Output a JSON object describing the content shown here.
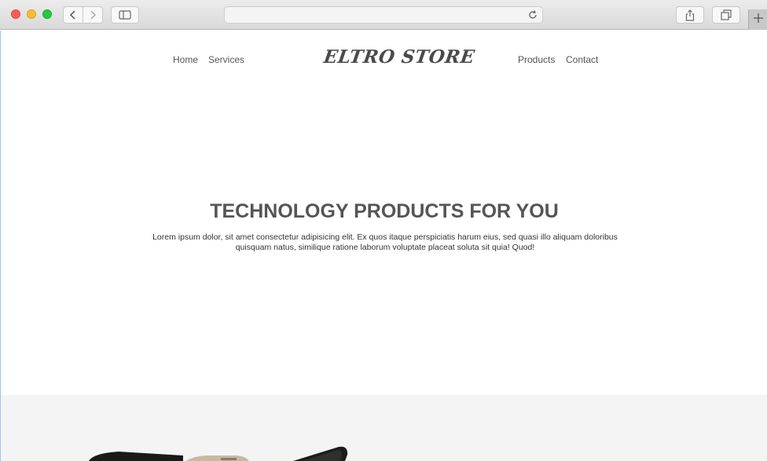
{
  "nav": {
    "home": "Home",
    "services": "Services",
    "products": "Products",
    "contact": "Contact"
  },
  "logo": "ELTRO STORE",
  "hero": {
    "title": "TECHNOLOGY PRODUCTS FOR YOU",
    "text": "Lorem ipsum dolor, sit amet consectetur adipisicing elit. Ex quos itaque perspiciatis harum eius, sed quasi illo aliquam doloribus quisquam natus, similique ratione laborum voluptate placeat soluta sit quia! Quod!"
  },
  "icons": {
    "back": "chevron-left-icon",
    "forward": "chevron-right-icon",
    "sidebar": "sidebar-icon",
    "reload": "reload-icon",
    "share": "share-icon",
    "tabs": "tabs-icon",
    "new_tab": "plus-icon"
  },
  "colors": {
    "traffic_red": "#fc5f57",
    "traffic_yellow": "#fdbc2e",
    "traffic_green": "#28c840",
    "products_bg": "#f4f4f4"
  }
}
